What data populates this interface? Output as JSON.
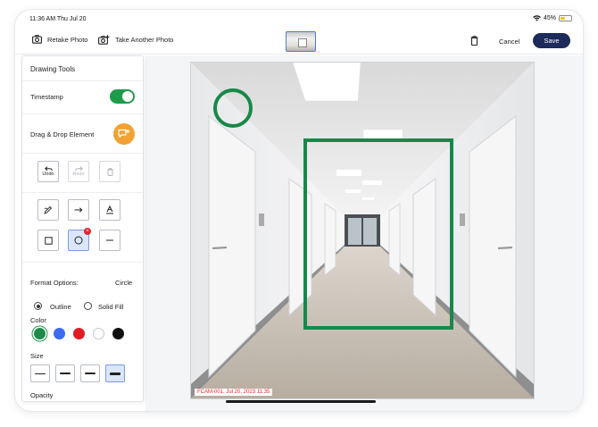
{
  "status_bar": {
    "time": "11:36 AM  Thu Jul 20",
    "battery": "45%",
    "battery_fraction": 0.45
  },
  "toolbar": {
    "retake_label": "Retake Photo",
    "take_another_label": "Take Another Photo",
    "cancel_label": "Cancel",
    "save_label": "Save"
  },
  "panel": {
    "title": "Drawing Tools",
    "timestamp_label": "Timestamp",
    "timestamp_on": true,
    "drag_drop_label": "Drag & Drop Element",
    "undo_label": "Undo",
    "redo_label": "Redo",
    "format_label": "Format Options:",
    "format_value": "Circle",
    "outline_label": "Outline",
    "solid_fill_label": "Solid Fill",
    "selected_fill": "Outline",
    "color_label": "Color",
    "colors": [
      "#1f8a4c",
      "#3d6af0",
      "#e01b24",
      "#ffffff",
      "#111111"
    ],
    "selected_color": "#1f8a4c",
    "size_label": "Size",
    "selected_size": 4,
    "opacity_label": "Opacity",
    "active_tool": "circle-tool"
  },
  "photo": {
    "stamp_text": "FCAM-001, Jul 20, 2023 11:35",
    "accent_color": "#18884a"
  }
}
